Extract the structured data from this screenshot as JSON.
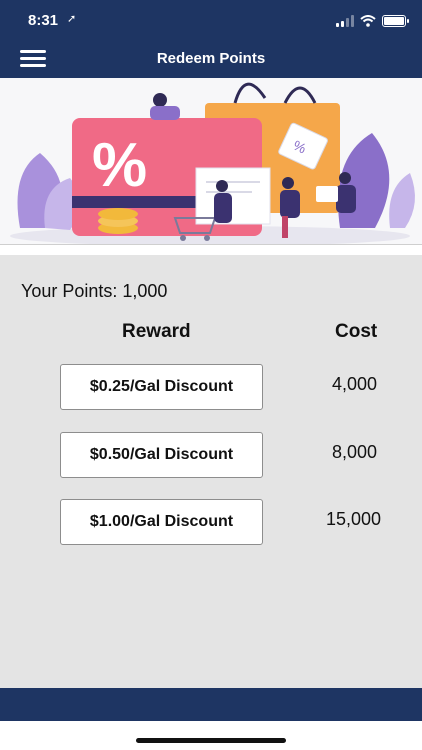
{
  "status_bar": {
    "time": "8:31",
    "location_glyph": "➚"
  },
  "header": {
    "title": "Redeem Points",
    "menu_icon": "hamburger-menu-icon"
  },
  "banner": {
    "percent_text": "%"
  },
  "points": {
    "label": "Your Points: 1,000"
  },
  "table": {
    "reward_header": "Reward",
    "cost_header": "Cost",
    "rows": [
      {
        "reward": "$0.25/Gal Discount",
        "cost": "4,000"
      },
      {
        "reward": "$0.50/Gal Discount",
        "cost": "8,000"
      },
      {
        "reward": "$1.00/Gal Discount",
        "cost": "15,000"
      }
    ]
  },
  "colors": {
    "header_bg": "#1e3563",
    "content_bg": "#e4e4e4",
    "button_bg": "#ffffff",
    "card_pink": "#f06a86",
    "bag_orange": "#f5a74a",
    "leaf_purple": "#8a6fc9"
  }
}
